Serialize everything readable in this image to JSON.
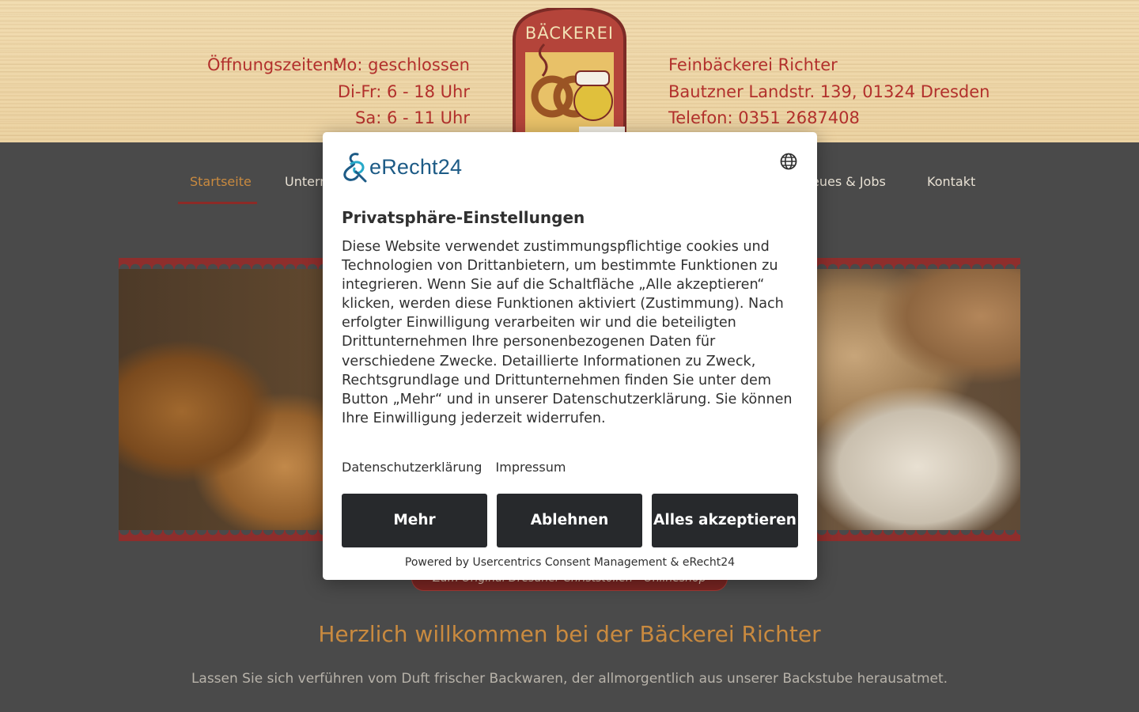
{
  "header": {
    "hours_label": "Öffnungszeiten:",
    "hours": [
      "Mo: geschlossen",
      "Di-Fr: 6 - 18 Uhr",
      "Sa: 6 - 11 Uhr"
    ],
    "logo_text": "BÄCKEREI",
    "contact": [
      "Feinbäckerei Richter",
      "Bautzner Landstr. 139, 01324 Dresden",
      "Telefon: 0351 2687408"
    ]
  },
  "nav": {
    "items": [
      "Startseite",
      "Untern",
      "eues & Jobs",
      "Kontakt"
    ],
    "active": "Startseite"
  },
  "main": {
    "shop_button": "Zum Original Dresdner Christstollen - Onlineshop",
    "welcome_heading": "Herzlich willkommen bei der Bäckerei Richter",
    "welcome_text": "Lassen Sie sich verführen vom Duft frischer Backwaren, der allmorgentlich aus unserer Backstube herausatmet."
  },
  "consent": {
    "brand": "eRecht24",
    "title": "Privatsphäre-Einstellungen",
    "body": "Diese Website verwendet zustimmungspflichtige cookies und Technologien von Drittanbietern, um bestimmte Funktionen zu integrieren. Wenn Sie auf die Schaltfläche „Alle akzeptieren“ klicken, werden diese Funktionen aktiviert (Zustimmung). Nach erfolgter Einwilligung verarbeiten wir und die beteiligten Drittunternehmen Ihre personenbezogenen Daten für verschiedene Zwecke. Detaillierte Informationen zu Zweck, Rechtsgrundlage und Drittunternehmen finden Sie unter dem Button „Mehr“ und in unserer Datenschutzerklärung. Sie können Ihre Einwilligung jederzeit widerrufen.",
    "links": [
      "Datenschutzerklärung",
      "Impressum"
    ],
    "buttons": {
      "more": "Mehr",
      "deny": "Ablehnen",
      "accept": "Alles akzeptieren"
    },
    "powered_by": "Powered by Usercentrics Consent Management & eRecht24"
  },
  "colors": {
    "header_text": "#b2302c",
    "accent": "#c98a3f",
    "button_bg": "#27292c",
    "brand_blue": "#1d5b86"
  }
}
